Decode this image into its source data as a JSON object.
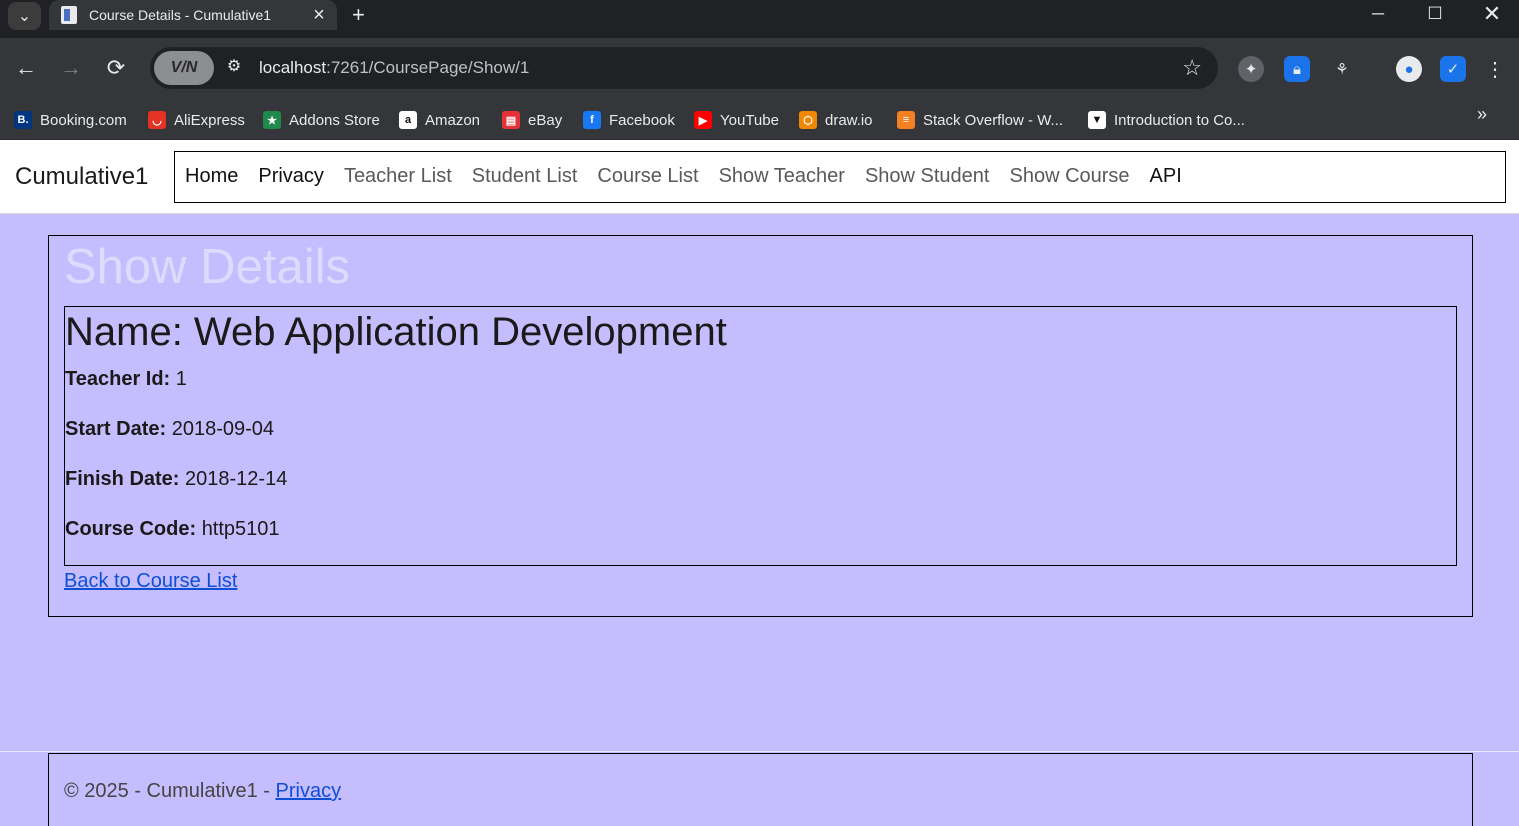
{
  "browser": {
    "tab_title": "Course Details - Cumulative1",
    "url_host": "localhost",
    "url_path": ":7261/CoursePage/Show/1",
    "vpn_label": "V/N",
    "bookmarks": [
      {
        "label": "Booking.com",
        "icon": "booking-icon",
        "color": "#003580",
        "glyph": "B."
      },
      {
        "label": "AliExpress",
        "icon": "aliexpress-icon",
        "color": "#e43225",
        "glyph": "◡"
      },
      {
        "label": "Addons Store",
        "icon": "addons-store-icon",
        "color": "#1f8a4c",
        "glyph": "★"
      },
      {
        "label": "Amazon",
        "icon": "amazon-icon",
        "color": "#ffffff",
        "glyph": "a"
      },
      {
        "label": "eBay",
        "icon": "ebay-icon",
        "color": "#e53238",
        "glyph": "▤"
      },
      {
        "label": "Facebook",
        "icon": "facebook-icon",
        "color": "#1877f2",
        "glyph": "f"
      },
      {
        "label": "YouTube",
        "icon": "youtube-icon",
        "color": "#ff0000",
        "glyph": "▶"
      },
      {
        "label": "draw.io",
        "icon": "drawio-icon",
        "color": "#f08705",
        "glyph": "⬡"
      },
      {
        "label": "Stack Overflow - W...",
        "icon": "stackoverflow-icon",
        "color": "#f48024",
        "glyph": "≡"
      },
      {
        "label": "Introduction to Co...",
        "icon": "brave-icon",
        "color": "#ffffff",
        "glyph": "▼"
      }
    ]
  },
  "site": {
    "brand": "Cumulative1",
    "nav": [
      "Home",
      "Privacy",
      "Teacher List",
      "Student List",
      "Course List",
      "Show Teacher",
      "Show Student",
      "Show Course",
      "API"
    ]
  },
  "main": {
    "heading": "Show Details",
    "course_name": "Name: Web Application Development",
    "teacher_id_label": "Teacher Id:",
    "teacher_id": "1",
    "start_date_label": "Start Date:",
    "start_date": "2018-09-04",
    "finish_date_label": "Finish Date:",
    "finish_date": "2018-12-14",
    "course_code_label": "Course Code:",
    "course_code": "http5101",
    "back_link": "Back to Course List"
  },
  "footer": {
    "copyright": "© 2025 - Cumulative1 - ",
    "privacy_link": "Privacy"
  },
  "colors": {
    "page_background": "#c5bdfd",
    "heading_color": "#dcdcff",
    "link_color": "#0d4fd6"
  }
}
